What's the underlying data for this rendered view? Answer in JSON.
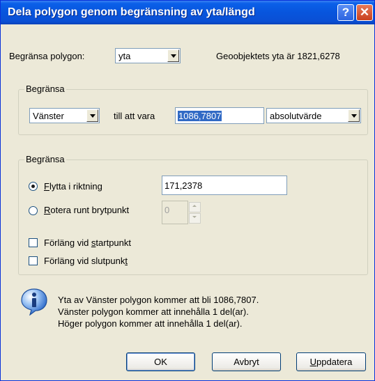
{
  "window": {
    "title": "Dela polygon genom begränsning av yta/längd",
    "help_label": "?",
    "close_label": "✕"
  },
  "top": {
    "constrain_label": "Begränsa polygon:",
    "constrain_value": "yta",
    "area_info": "Geoobjektets yta är 1821,6278"
  },
  "group1": {
    "legend": "Begränsa",
    "side_value": "Vänster",
    "to_be_label": "till att vara",
    "value_input": "1086,7807",
    "mode_value": "absolutvärde"
  },
  "group2": {
    "legend": "Begränsa",
    "move_first": "F",
    "move_rest": "lytta i riktning",
    "move_value": "171,2378",
    "rotate_first": "R",
    "rotate_rest": "otera runt brytpunkt",
    "rotate_value": "0",
    "extend_start_a": "Förläng vid ",
    "extend_start_u": "s",
    "extend_start_b": "tartpunkt",
    "extend_end_a": "Förläng vid slutpunk",
    "extend_end_u": "t"
  },
  "info": {
    "line1": "Yta av Vänster polygon kommer att bli 1086,7807.",
    "line2": "Vänster polygon kommer att innehålla 1 del(ar).",
    "line3": "Höger polygon kommer att innehålla 1 del(ar)."
  },
  "buttons": {
    "ok": "OK",
    "cancel": "Avbryt",
    "update_first": "U",
    "update_rest": "ppdatera"
  }
}
